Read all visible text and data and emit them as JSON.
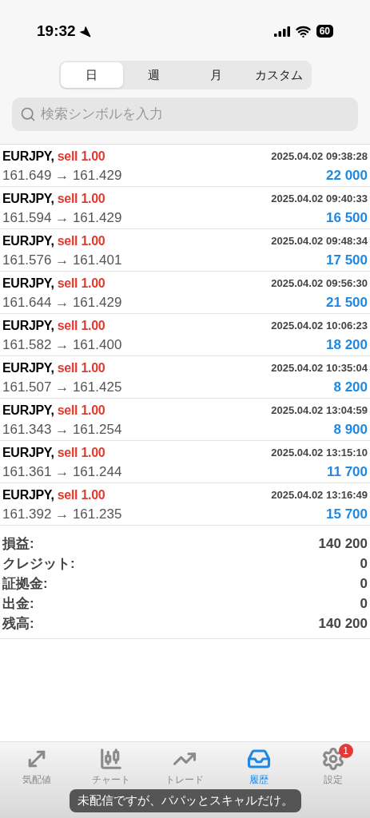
{
  "status_bar": {
    "time": "19:32",
    "battery": "60"
  },
  "period_tabs": [
    {
      "label": "日",
      "selected": true
    },
    {
      "label": "週",
      "selected": false
    },
    {
      "label": "月",
      "selected": false
    },
    {
      "label": "カスタム",
      "selected": false
    }
  ],
  "search": {
    "placeholder": "検索シンボルを入力"
  },
  "trades": [
    {
      "symbol": "EURJPY,",
      "side": "sell 1.00",
      "prices": "161.649 → 161.429",
      "time": "2025.04.02 09:38:28",
      "profit": "22 000"
    },
    {
      "symbol": "EURJPY,",
      "side": "sell 1.00",
      "prices": "161.594 → 161.429",
      "time": "2025.04.02 09:40:33",
      "profit": "16 500"
    },
    {
      "symbol": "EURJPY,",
      "side": "sell 1.00",
      "prices": "161.576 → 161.401",
      "time": "2025.04.02 09:48:34",
      "profit": "17 500"
    },
    {
      "symbol": "EURJPY,",
      "side": "sell 1.00",
      "prices": "161.644 → 161.429",
      "time": "2025.04.02 09:56:30",
      "profit": "21 500"
    },
    {
      "symbol": "EURJPY,",
      "side": "sell 1.00",
      "prices": "161.582 → 161.400",
      "time": "2025.04.02 10:06:23",
      "profit": "18 200"
    },
    {
      "symbol": "EURJPY,",
      "side": "sell 1.00",
      "prices": "161.507 → 161.425",
      "time": "2025.04.02 10:35:04",
      "profit": "8 200"
    },
    {
      "symbol": "EURJPY,",
      "side": "sell 1.00",
      "prices": "161.343 → 161.254",
      "time": "2025.04.02 13:04:59",
      "profit": "8 900"
    },
    {
      "symbol": "EURJPY,",
      "side": "sell 1.00",
      "prices": "161.361 → 161.244",
      "time": "2025.04.02 13:15:10",
      "profit": "11 700"
    },
    {
      "symbol": "EURJPY,",
      "side": "sell 1.00",
      "prices": "161.392 → 161.235",
      "time": "2025.04.02 13:16:49",
      "profit": "15 700"
    }
  ],
  "summary": [
    {
      "label": "損益:",
      "value": "140 200"
    },
    {
      "label": "クレジット:",
      "value": "0"
    },
    {
      "label": "証拠金:",
      "value": "0"
    },
    {
      "label": "出金:",
      "value": "0"
    },
    {
      "label": "残高:",
      "value": "140 200"
    }
  ],
  "nav": [
    {
      "kind": "quotes",
      "label": "気配値",
      "selected": false
    },
    {
      "kind": "chart",
      "label": "チャート",
      "selected": false
    },
    {
      "kind": "trade",
      "label": "トレード",
      "selected": false
    },
    {
      "kind": "history",
      "label": "履歴",
      "selected": true
    },
    {
      "kind": "settings",
      "label": "設定",
      "selected": false,
      "badge": "1"
    }
  ],
  "caption": "未配信ですが、パパッとスキャルだけ。"
}
